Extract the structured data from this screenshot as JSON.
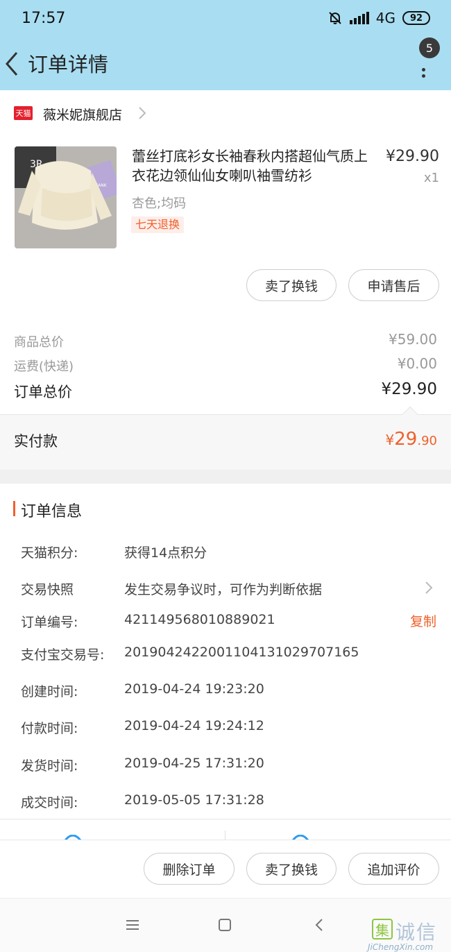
{
  "status_bar": {
    "time": "17:57",
    "network": "4G",
    "battery": "92"
  },
  "header": {
    "title": "订单详情",
    "badge_count": "5"
  },
  "shop": {
    "logo_text": "天猫",
    "name": "薇米妮旗舰店"
  },
  "product": {
    "title": "蕾丝打底衫女长袖春秋内搭超仙气质上衣花边领仙仙女喇叭袖雪纺衫",
    "price": "¥29.90",
    "quantity": "x1",
    "sku": "杏色;均码",
    "tag": "七天退换",
    "image_text": "3R",
    "image_label": "THANK"
  },
  "product_actions": {
    "sell": "卖了换钱",
    "after_sale": "申请售后"
  },
  "summary": {
    "goods_total_label": "商品总价",
    "goods_total_value": "¥59.00",
    "shipping_label": "运费(快递)",
    "shipping_value": "¥0.00",
    "order_total_label": "订单总价",
    "order_total_value": "¥29.90",
    "paid_label": "实付款",
    "paid_symbol": "¥",
    "paid_int": "29",
    "paid_dec": ".90"
  },
  "order_info": {
    "title": "订单信息",
    "rows": [
      {
        "label": "天猫积分:",
        "value": "获得14点积分"
      },
      {
        "label": "交易快照",
        "value": "发生交易争议时，可作为判断依据"
      },
      {
        "label": "订单编号:",
        "value": "421149568010889021"
      },
      {
        "label": "支付宝交易号:",
        "value": "2019042422001104131029707165"
      },
      {
        "label": "创建时间:",
        "value": "2019-04-24 19:23:20"
      },
      {
        "label": "付款时间:",
        "value": "2019-04-24 19:24:12"
      },
      {
        "label": "发货时间:",
        "value": "2019-04-25 17:31:20"
      },
      {
        "label": "成交时间:",
        "value": "2019-05-05 17:31:28"
      }
    ],
    "copy_label": "复制"
  },
  "bottom_actions": {
    "delete": "删除订单",
    "sell": "卖了换钱",
    "review": "追加评价"
  },
  "watermark": {
    "mark": "集",
    "text": "诚信",
    "url": "JiChengXin.com"
  },
  "colors": {
    "header_bg": "#a9def2",
    "accent": "#f0602a",
    "tmall_red": "#e4202e"
  }
}
